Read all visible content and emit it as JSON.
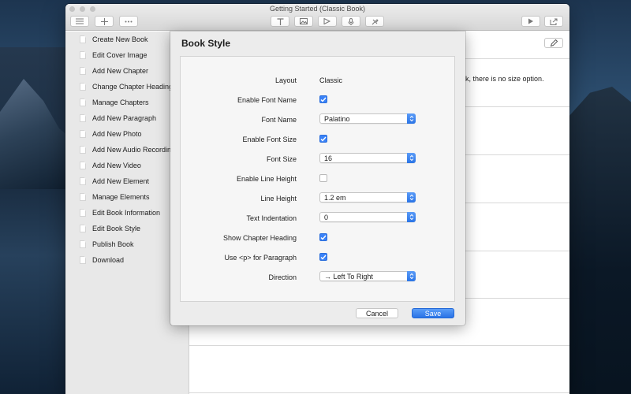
{
  "window": {
    "title": "Getting Started (Classic Book)"
  },
  "sidebar": {
    "items": [
      {
        "label": "Create New Book"
      },
      {
        "label": "Edit Cover Image"
      },
      {
        "label": "Add New Chapter"
      },
      {
        "label": "Change Chapter Heading"
      },
      {
        "label": "Manage Chapters"
      },
      {
        "label": "Add New Paragraph"
      },
      {
        "label": "Add New Photo"
      },
      {
        "label": "Add New Audio Recording"
      },
      {
        "label": "Add New Video"
      },
      {
        "label": "Add New Element"
      },
      {
        "label": "Manage Elements"
      },
      {
        "label": "Edit Book Information"
      },
      {
        "label": "Edit Book Style"
      },
      {
        "label": "Publish Book"
      },
      {
        "label": "Download"
      }
    ]
  },
  "main": {
    "partial_text": "ook, there is no size option."
  },
  "sheet": {
    "title": "Book Style",
    "layout": {
      "label": "Layout",
      "value": "Classic"
    },
    "enable_font_name": {
      "label": "Enable Font Name",
      "checked": true
    },
    "font_name": {
      "label": "Font Name",
      "value": "Palatino"
    },
    "enable_font_size": {
      "label": "Enable Font Size",
      "checked": true
    },
    "font_size": {
      "label": "Font Size",
      "value": "16"
    },
    "enable_line_height": {
      "label": "Enable Line Height",
      "checked": false
    },
    "line_height": {
      "label": "Line Height",
      "value": "1.2 em"
    },
    "text_indentation": {
      "label": "Text Indentation",
      "value": "0"
    },
    "show_chapter_heading": {
      "label": "Show Chapter Heading",
      "checked": true
    },
    "use_p": {
      "label": "Use <p> for Paragraph",
      "checked": true
    },
    "direction": {
      "label": "Direction",
      "value": "→ Left To Right"
    },
    "cancel_label": "Cancel",
    "save_label": "Save"
  },
  "colors": {
    "accent": "#3a82f7",
    "sidebar_bg": "#e8e8e8",
    "sheet_bg": "#ececec"
  },
  "icons": {
    "toolbar": [
      "list-icon",
      "plus-icon",
      "ellipsis-icon",
      "text-icon",
      "image-icon",
      "video-icon",
      "audio-icon",
      "tools-icon",
      "play-icon",
      "export-icon"
    ],
    "edit": "pencil-icon"
  }
}
